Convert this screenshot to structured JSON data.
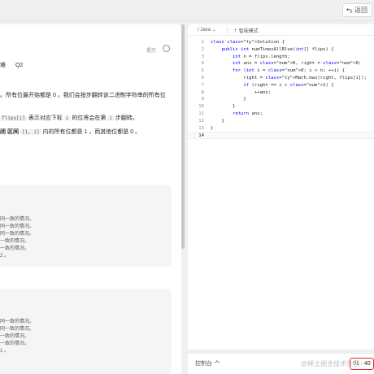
{
  "topbar": {
    "back_label": "返回"
  },
  "problem": {
    "hint_label": "提示",
    "tags": [
      "难",
      "Q2"
    ],
    "desc": [
      "。所有位最开始都是 0 。我们会按步翻转该二进制字符串的所有位",
      "flips[i]",
      " 表示对应下标 ",
      "i",
      " 的位将会在第 ",
      "i",
      " 步翻转。",
      "闭 区间 ",
      "[1, i]",
      " 内的所有位都是 1 ，而其他位都是 0 。"
    ],
    "example1": [
      "同一致的情况。",
      "同一致的情况。",
      "同一致的情况。",
      "一致的情况。",
      "一致的情况。",
      "2 。"
    ],
    "example2": [
      "同一致的情况。",
      "同一致的情况。",
      "一致的情况。",
      "一致的情况。",
      "1 。"
    ]
  },
  "editor": {
    "language": "Java",
    "mode_label": "智能模式",
    "line_numbers": [
      "1",
      "2",
      "3",
      "4",
      "5",
      "6",
      "7",
      "8",
      "9",
      "10",
      "11",
      "12",
      "13",
      "14"
    ],
    "code": [
      "class Solution {",
      "    public int numTimesAllBlue(int[] flips) {",
      "        int n = flips.length;",
      "        int ans = 0, right = 0;",
      "        for (int i = 0; i < n; ++i) {",
      "            right = Math.max(right, flips[i]);",
      "            if (right == i + 1) {",
      "                ++ans;",
      "            }",
      "        }",
      "        return ans;",
      "    }",
      "}",
      ""
    ]
  },
  "console": {
    "label": "控制台",
    "timer": "01 : 40"
  },
  "watermark": "@稀土掘金技术社区",
  "colors": {
    "keyword": "#0000ff",
    "type": "#267f99",
    "number": "#098658",
    "timer_border": "#f5222d"
  }
}
